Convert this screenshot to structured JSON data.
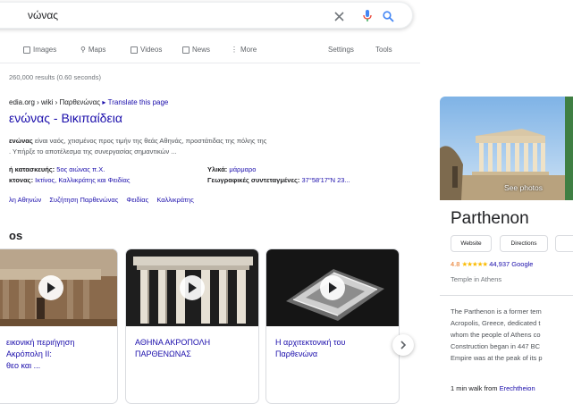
{
  "search": {
    "query": "νώνας"
  },
  "tabs": [
    {
      "label": "Images",
      "icon": "image-icon"
    },
    {
      "label": "Maps",
      "icon": "map-pin-icon"
    },
    {
      "label": "Videos",
      "icon": "video-icon"
    },
    {
      "label": "News",
      "icon": "news-icon"
    },
    {
      "label": "More",
      "icon": "more-icon"
    }
  ],
  "tools": {
    "settings": "Settings",
    "tools": "Tools"
  },
  "stats": "260,000 results (0.60 seconds)",
  "result": {
    "url": "edia.org › wiki › Παρθενώνας",
    "translate": "Translate this page",
    "title": "ενώνας - Βικιπαίδεια",
    "snippet_bold": "ενώνας",
    "snippet_rest": " είναι ναός, χτισμένος προς τιμήν της θεάς Αθηνάς, προστάτιδας της πόλης της",
    "snippet_line2": ". Υπήρξε το αποτέλεσμα της συνεργασίας σημαντικών ...",
    "facts": [
      {
        "label": "ή κατασκευής:",
        "value": " 5ος αιώνας π.Χ."
      },
      {
        "label": "Υλικά:",
        "value": " μάρμαρο"
      },
      {
        "label": "κτονας:",
        "value": " Ικτίνος, Καλλικράτης και Φειδίας"
      },
      {
        "label": "Γεωγραφικές συντεταγμένες:",
        "value": " 37°58′17″N 23..."
      }
    ],
    "sitelinks": [
      "λη Αθηνών",
      "Συζήτηση Παρθενώνας",
      "Φειδίας",
      "Καλλικράτης"
    ]
  },
  "videos": {
    "heading": "os",
    "items": [
      {
        "title": "εικονική περιήγηση\n Ακρόπολη II:\nθεο και ..."
      },
      {
        "title": "ΑΘΗΝΑ ΑΚΡΟΠΟΛΗ\nΠΑΡΘΕΝΩΝΑΣ"
      },
      {
        "title": "Η αρχιτεκτονική του\nΠαρθενώνα"
      }
    ]
  },
  "knowledge_panel": {
    "see_photos": "See photos",
    "title": "Parthenon",
    "buttons": [
      "Website",
      "Directions"
    ],
    "rating": "4.8",
    "stars": 5,
    "reviews": "44,937 Google",
    "type": "Temple in Athens",
    "description_lines": [
      "The Parthenon is a former tem",
      "Acropolis, Greece, dedicated t",
      "whom the people of Athens co",
      "Construction began in 447 BC",
      "Empire was at the peak of its p"
    ],
    "walk_prefix": "1 min walk from ",
    "walk_link": "Erechtheion"
  },
  "colors": {
    "link": "#1a0dab",
    "mic_blue": "#4285f4",
    "mic_red": "#ea4335",
    "star": "#fbbc04"
  }
}
